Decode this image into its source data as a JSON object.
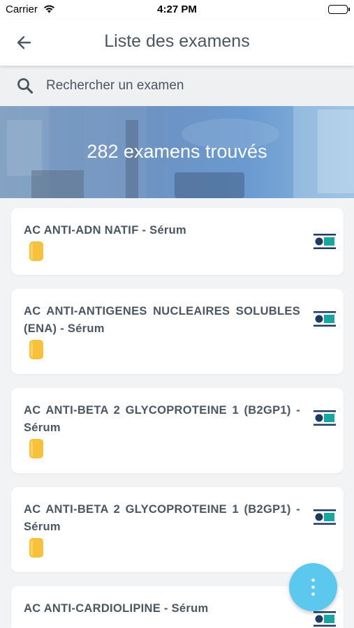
{
  "status_bar": {
    "carrier": "Carrier",
    "time": "4:27 PM"
  },
  "header": {
    "title": "Liste des examens"
  },
  "search": {
    "placeholder": "Rechercher un examen"
  },
  "banner": {
    "count_text": "282 examens trouvés"
  },
  "exams": [
    {
      "name": "AC ANTI-ADN NATIF - Sérum"
    },
    {
      "name": "AC ANTI-ANTIGENES NUCLEAIRES SOLUBLES (ENA) - Sérum"
    },
    {
      "name": "AC ANTI-BETA 2 GLYCOPROTEINE 1 (B2GP1) - Sérum"
    },
    {
      "name": "AC ANTI-BETA 2 GLYCOPROTEINE 1 (B2GP1) - Sérum"
    },
    {
      "name": "AC ANTI-CARDIOLIPINE - Sérum"
    }
  ],
  "colors": {
    "tube": "#f6c23e",
    "doc_dark": "#1e3a5f",
    "doc_teal": "#17a6a0",
    "fab": "#5cc8ee"
  },
  "icons": {
    "back": "arrow-left-icon",
    "search": "search-icon",
    "tube": "yellow-tube-icon",
    "doc": "document-icon",
    "fab": "more-vertical-icon"
  }
}
